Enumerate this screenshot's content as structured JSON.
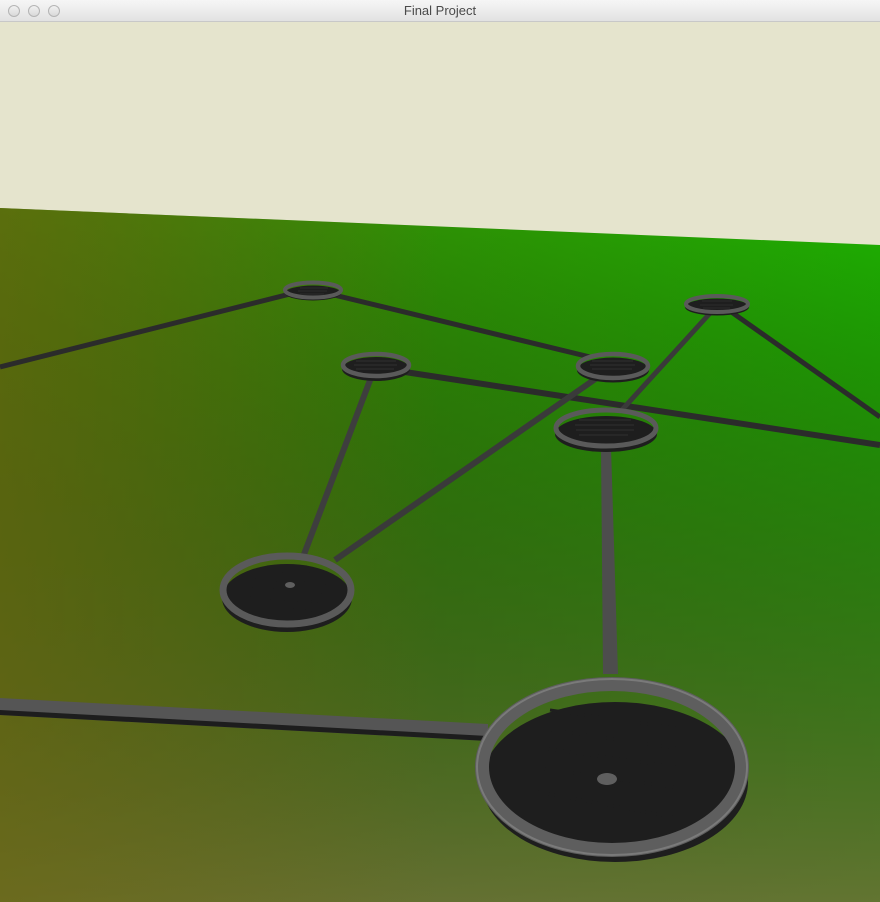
{
  "window": {
    "title": "Final Project",
    "controls": [
      "close-button",
      "minimize-button",
      "zoom-button"
    ]
  },
  "scene": {
    "sky_color": "#e5e4cd",
    "ground_colors": {
      "far_left": "#2d7a0a",
      "far_right": "#1db400",
      "near_left": "#6b6e22",
      "near_right": "#5a8a45"
    },
    "node_color": "#5f5f5f",
    "edge_color": "#4a4a4a",
    "node_count": 7,
    "edge_count": 9
  }
}
